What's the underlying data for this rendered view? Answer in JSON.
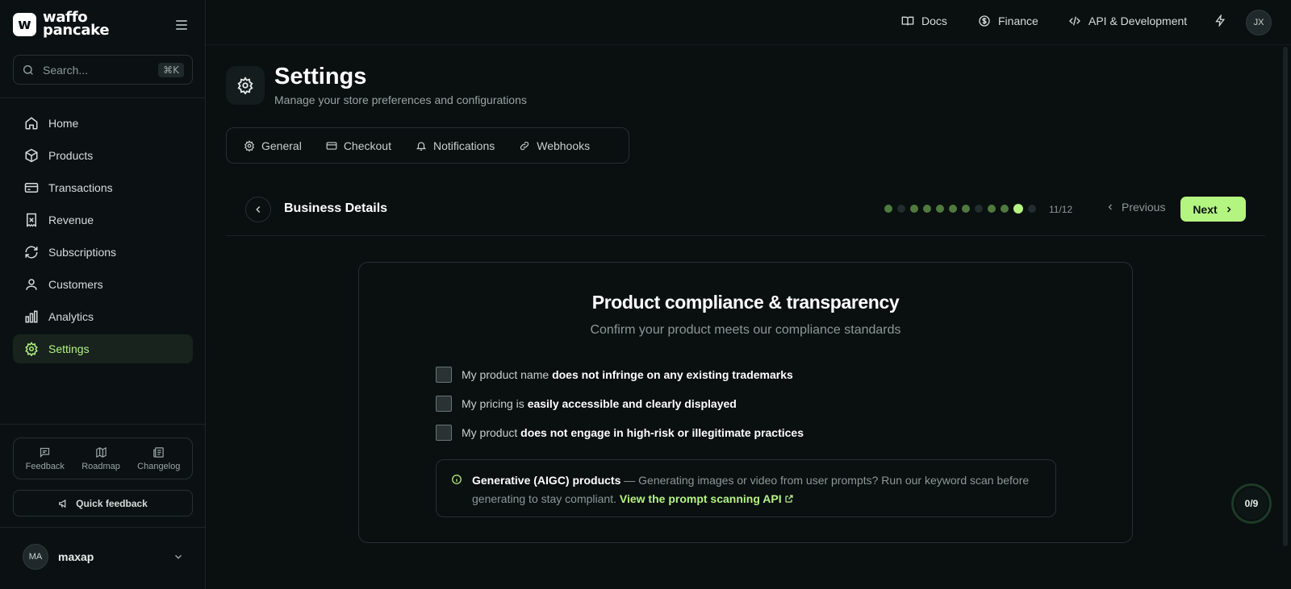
{
  "brand": {
    "logo_mark": "w",
    "line1": "waffo",
    "line2": "pancake"
  },
  "search": {
    "placeholder": "Search...",
    "shortcut": "⌘K"
  },
  "sidebar": {
    "items": [
      {
        "label": "Home",
        "icon": "home-icon"
      },
      {
        "label": "Products",
        "icon": "box-icon"
      },
      {
        "label": "Transactions",
        "icon": "credit-card-icon"
      },
      {
        "label": "Revenue",
        "icon": "receipt-icon"
      },
      {
        "label": "Subscriptions",
        "icon": "refresh-icon"
      },
      {
        "label": "Customers",
        "icon": "user-icon"
      },
      {
        "label": "Analytics",
        "icon": "bar-chart-icon"
      },
      {
        "label": "Settings",
        "icon": "gear-icon",
        "active": true
      }
    ],
    "footer_links": [
      {
        "label": "Feedback",
        "icon": "message-icon"
      },
      {
        "label": "Roadmap",
        "icon": "map-icon"
      },
      {
        "label": "Changelog",
        "icon": "newspaper-icon"
      }
    ],
    "quick_feedback": "Quick feedback",
    "user": {
      "initials": "MA",
      "name": "maxap"
    }
  },
  "topbar": {
    "links": [
      {
        "label": "Docs",
        "icon": "book-icon"
      },
      {
        "label": "Finance",
        "icon": "dollar-circle-icon"
      },
      {
        "label": "API & Development",
        "icon": "code-icon"
      }
    ],
    "avatar_initials": "JX"
  },
  "page": {
    "title": "Settings",
    "subtitle": "Manage your store preferences and configurations",
    "tabs": [
      {
        "label": "General",
        "icon": "gear-icon"
      },
      {
        "label": "Checkout",
        "icon": "credit-card-icon"
      },
      {
        "label": "Notifications",
        "icon": "bell-icon"
      },
      {
        "label": "Webhooks",
        "icon": "link-icon"
      }
    ]
  },
  "step": {
    "title": "Business Details",
    "total": 12,
    "current": 11,
    "done_steps": [
      1,
      3,
      4,
      5,
      6,
      7,
      9,
      10
    ],
    "counter": "11/12",
    "previous_label": "Previous",
    "next_label": "Next"
  },
  "compliance": {
    "title": "Product compliance & transparency",
    "subtitle": "Confirm your product meets our compliance standards",
    "checks": [
      {
        "prefix": "My product name ",
        "bold": "does not infringe on any existing trademarks",
        "checked": false
      },
      {
        "prefix": "My pricing is ",
        "bold": "easily accessible and clearly displayed",
        "checked": false
      },
      {
        "prefix": "My product ",
        "bold": "does not engage in high-risk or illegitimate practices",
        "checked": false
      }
    ],
    "info": {
      "bold": "Generative (AIGC) products",
      "text": " — Generating images or video from user prompts? Run our keyword scan before generating to stay compliant. ",
      "link": "View the prompt scanning API"
    }
  },
  "progress_badge": "0/9",
  "colors": {
    "accent": "#b4f481",
    "background": "#0a0f10",
    "done_dot": "#4f7a3e"
  }
}
